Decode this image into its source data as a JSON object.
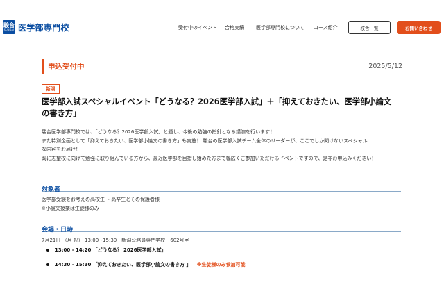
{
  "header": {
    "logo_mark_kanji": "駿台",
    "logo_mark_roman": "SUNDAI",
    "logo_text": "医学部専門校",
    "nav": [
      {
        "label": "受付中のイベント"
      },
      {
        "label": "合格実績"
      },
      {
        "label": "医学部専門校について"
      },
      {
        "label": "コース紹介"
      }
    ],
    "school_list_button": "校舎一覧",
    "contact_button": "お問い合わせ"
  },
  "event": {
    "status": "申込受付中",
    "date": "2025/5/12",
    "region": "新潟",
    "title_line1": "医学部入試スペシャルイベント「どうなる？2026医学部入試」＋「抑えておきたい、医学部小論文",
    "title_line2": "の書き方」",
    "description": [
      "駿台医学部専門校では、「どうなる？2026医学部入試」と題し、今後の勉強の指針となる講演を行います！",
      "また特別企画として「抑えておきたい、医学部小論文の書き方」も実施！ 駿台の医学部入試チーム全体のリーダーが、ここでしか聞けないスペシャル",
      "な内容をお届け！",
      "既に志望校に向けて勉強に取り組んでいる方から、最近医学部を目指し始めた方まで幅広くご参加いただけるイベントですので、是非お申込みください！"
    ]
  },
  "target": {
    "heading": "対象者",
    "line1": "医学部受験をお考えの高校生 ・高卒生とその保護者様",
    "line2": "※小論文授業は生徒様のみ"
  },
  "venue": {
    "heading": "会場・日時",
    "info": "7月21日 （月 祝） 13:00~15:30　新潟公務員専門学校　602号室",
    "schedule": [
      {
        "time": "13:00 - 14:20",
        "title": "「どうなる？ 2026医学部入試」",
        "note": ""
      },
      {
        "time": "14:30 - 15:30",
        "title": "「抑えておきたい、医学部小論文の書き方 」",
        "note": "※生徒様のみ参加可能"
      }
    ]
  },
  "colors": {
    "brand_blue": "#0b4ea2",
    "accent_orange": "#e24e1b"
  }
}
